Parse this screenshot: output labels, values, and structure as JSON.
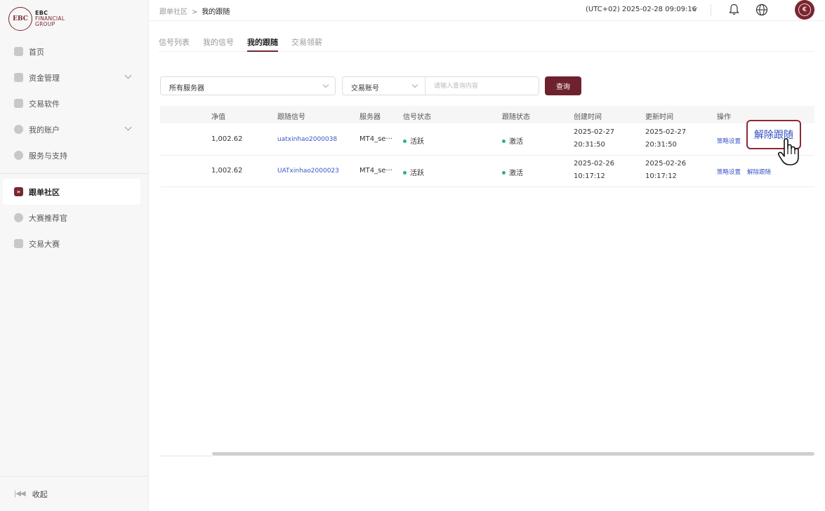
{
  "logo": {
    "mark": "EBC",
    "line1": "EBC",
    "line2": "FINANCIAL",
    "line3": "GROUP"
  },
  "sidebar": {
    "items": [
      {
        "label": "首页",
        "icon": "home-icon"
      },
      {
        "label": "资金管理",
        "icon": "wallet-icon",
        "expandable": true
      },
      {
        "label": "交易软件",
        "icon": "box-icon"
      },
      {
        "label": "我的账户",
        "icon": "user-icon",
        "expandable": true
      },
      {
        "label": "服务与支持",
        "icon": "help-icon"
      }
    ],
    "active_item": {
      "label": "跟单社区",
      "icon": "copy-trade-icon"
    },
    "items2": [
      {
        "label": "大赛推荐官",
        "icon": "referrer-icon"
      },
      {
        "label": "交易大赛",
        "icon": "trophy-icon"
      }
    ],
    "collapse_label": "收起"
  },
  "header": {
    "breadcrumb_parent": "跟单社区",
    "breadcrumb_current": "我的跟随",
    "timezone": "(UTC+02)  2025-02-28 09:09:16"
  },
  "tabs": [
    "信号列表",
    "我的信号",
    "我的跟随",
    "交易领薪"
  ],
  "active_tab_index": 2,
  "filters": {
    "server_select": "所有服务器",
    "account_select": "交易账号",
    "search_placeholder": "请输入查询内容",
    "query_button": "查询"
  },
  "table": {
    "columns": [
      "净值",
      "跟随信号",
      "服务器",
      "信号状态",
      "跟随状态",
      "创建时间",
      "更新时间",
      "操作"
    ],
    "rows": [
      {
        "equity": "1,002.62",
        "signal": "uatxinhao2000038",
        "server": "MT4_se···",
        "signal_status": "活跃",
        "follow_status": "激活",
        "created_date": "2025-02-27",
        "created_time": "20:31:50",
        "updated_date": "2025-02-27",
        "updated_time": "20:31:50",
        "action1": "策略设置",
        "action2": "解除跟随"
      },
      {
        "equity": "1,002.62",
        "signal": "UATxinhao2000023",
        "server": "MT4_se···",
        "signal_status": "活跃",
        "follow_status": "激活",
        "created_date": "2025-02-26",
        "created_time": "10:17:12",
        "updated_date": "2025-02-26",
        "updated_time": "10:17:12",
        "action1": "策略设置",
        "action2": "解除跟随"
      }
    ]
  },
  "colors": {
    "brand": "#7a2630",
    "link": "#3b56c9",
    "active_dot": "#2bb673"
  }
}
